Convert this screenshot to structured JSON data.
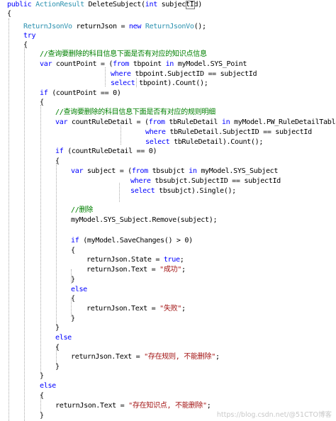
{
  "colors": {
    "keyword": "#0000ff",
    "type": "#2b91af",
    "string": "#a31515",
    "comment": "#008000",
    "text": "#000000",
    "guide": "#a9a9a9"
  },
  "code": {
    "l01": {
      "a": "public ",
      "b": "ActionResult",
      "c": " DeleteSubject(",
      "d": "int",
      "e": " subjectId)"
    },
    "l02": "{",
    "l03": {
      "a": "ReturnJsonVo",
      "b": " returnJson = ",
      "c": "new",
      "d": " ",
      "e": "ReturnJsonVo",
      "f": "();"
    },
    "l04": "try",
    "l05": "{",
    "l06": "//查询要删除的科目信息下面是否有对应的知识点信息",
    "l07": {
      "a": "var",
      "b": " countPoint = (",
      "c": "from",
      "d": " tbpoint ",
      "e": "in",
      "f": " myModel.SYS_Point"
    },
    "l08": {
      "a": "where",
      "b": " tbpoint.SubjectID == subjectId"
    },
    "l09": {
      "a": "select",
      "b": " tbpoint).Count();"
    },
    "l10": {
      "a": "if",
      "b": " (countPoint == 0)"
    },
    "l11": "{",
    "l12": "//查询要删除的科目信息下面是否有对应的规则明细",
    "l13": {
      "a": "var",
      "b": " countRuleDetail = (",
      "c": "from",
      "d": " tbRuleDetail ",
      "e": "in",
      "f": " myModel.PW_RuleDetailTable"
    },
    "l14": {
      "a": "where",
      "b": " tbRuleDetail.SubjectID == subjectId"
    },
    "l15": {
      "a": "select",
      "b": " tbRuleDetail).Count();"
    },
    "l16": {
      "a": "if",
      "b": " (countRuleDetail == 0)"
    },
    "l17": "{",
    "l18": {
      "a": "var",
      "b": " subject = (",
      "c": "from",
      "d": " tbsubjct ",
      "e": "in",
      "f": " myModel.SYS_Subject"
    },
    "l19": {
      "a": "where",
      "b": " tbsubjct.SubjectID == subjectId"
    },
    "l20": {
      "a": "select",
      "b": " tbsubjct).Single();"
    },
    "l21": "//删除",
    "l22": "myModel.SYS_Subject.Remove(subject);",
    "l23": {
      "a": "if",
      "b": " (myModel.SaveChanges() > 0)"
    },
    "l24": "{",
    "l25": {
      "a": "returnJson.State = ",
      "b": "true",
      "c": ";"
    },
    "l26": {
      "a": "returnJson.Text = ",
      "b": "\"成功\"",
      "c": ";"
    },
    "l27": "}",
    "l28": "else",
    "l29": "{",
    "l30": {
      "a": "returnJson.Text = ",
      "b": "\"失败\"",
      "c": ";"
    },
    "l31": "}",
    "l32": "}",
    "l33": "else",
    "l34": "{",
    "l35": {
      "a": "returnJson.Text = ",
      "b": "\"存在规则, 不能删除\"",
      "c": ";"
    },
    "l36": "}",
    "l37": "}",
    "l38": "else",
    "l39": "{",
    "l40": {
      "a": "returnJson.Text = ",
      "b": "\"存在知识点, 不能删除\"",
      "c": ";"
    },
    "l41": "}"
  },
  "watermark": "https://blog.csdn.net/@51CTO博客"
}
